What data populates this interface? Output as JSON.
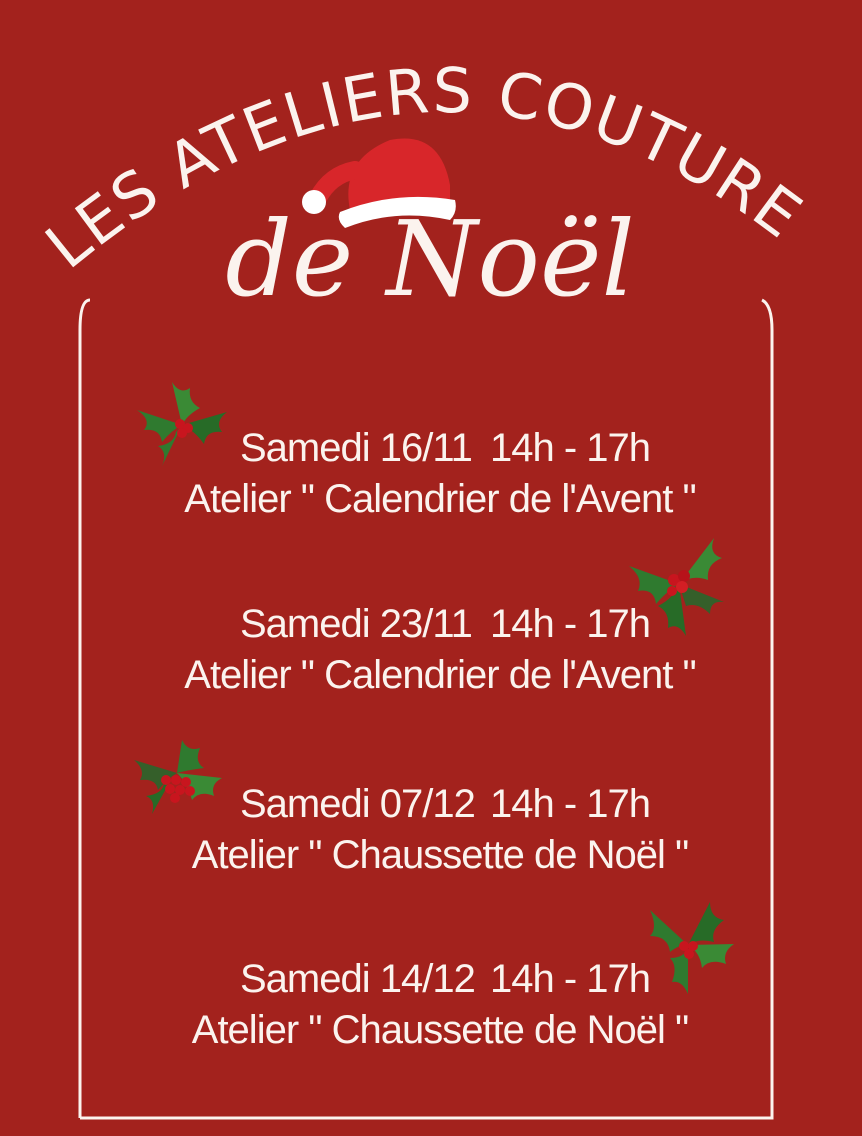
{
  "header": {
    "arc_title": "LES ATELIERS COUTURE",
    "script_title": "de Noël"
  },
  "events": [
    {
      "date": "Samedi 16/11",
      "time": "14h - 17h",
      "workshop": "Atelier \" Calendrier de l'Avent \""
    },
    {
      "date": "Samedi 23/11",
      "time": "14h - 17h",
      "workshop": "Atelier \" Calendrier de l'Avent \""
    },
    {
      "date": "Samedi 07/12",
      "time": "14h - 17h",
      "workshop": "Atelier \" Chaussette de Noël \""
    },
    {
      "date": "Samedi 14/12",
      "time": "14h - 17h",
      "workshop": "Atelier \" Chaussette de Noël \""
    }
  ],
  "colors": {
    "background": "#a3221d",
    "text": "#fbf3ee",
    "hat_red": "#d8262a",
    "holly_green": "#2f7a2f",
    "berry_red": "#c8151e"
  },
  "icons": [
    "santa-hat-icon",
    "holly-icon"
  ]
}
